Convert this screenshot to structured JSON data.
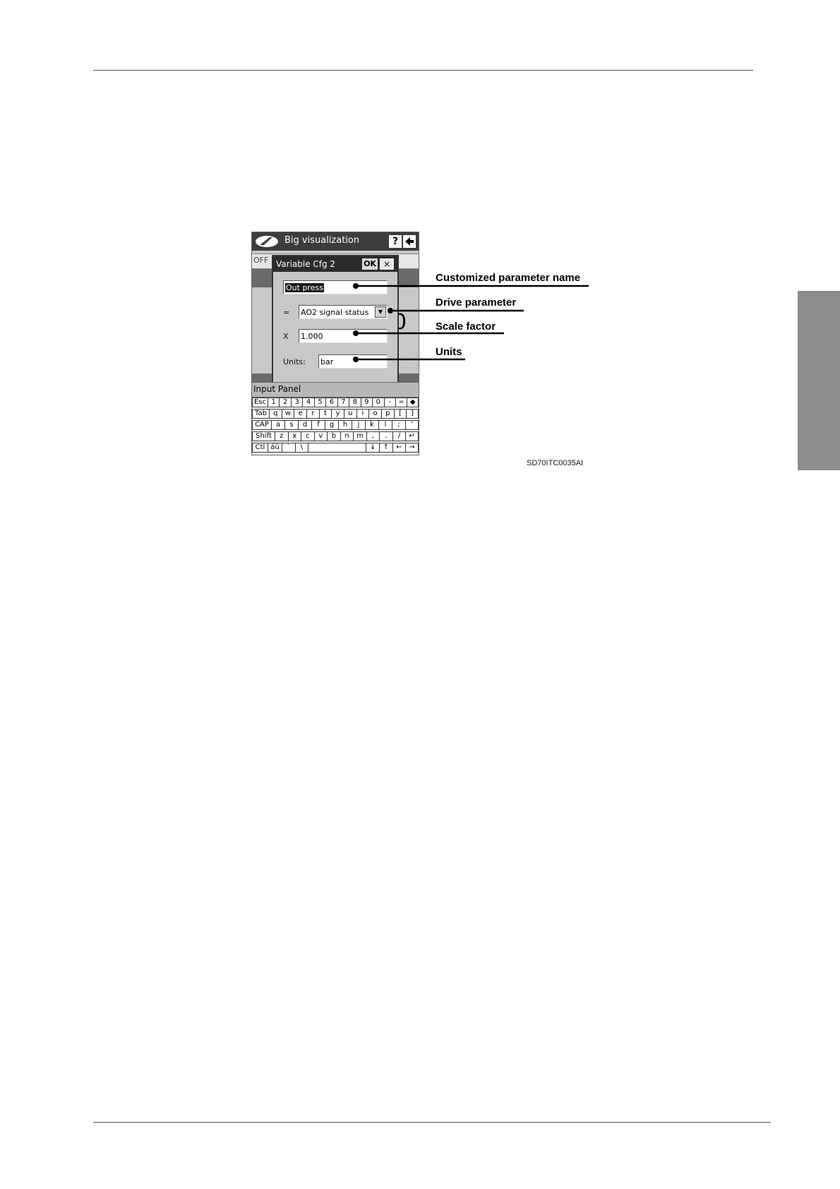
{
  "screen": {
    "app_title": "Big visualization",
    "help_icon": "help-icon",
    "back_icon": "back-arrow-icon",
    "background_off_label": "OFF"
  },
  "dialog": {
    "title": "Variable Cfg 2",
    "ok_label": "OK",
    "close_label": "×",
    "name_value": "Out press",
    "param_prefix": "=",
    "param_value": "AO2 signal status",
    "scale_prefix": "X",
    "scale_value": "1.000",
    "units_label": "Units:",
    "units_value": "bar"
  },
  "input_panel": {
    "title": "Input Panel",
    "rows": [
      [
        "Esc",
        "1",
        "2",
        "3",
        "4",
        "5",
        "6",
        "7",
        "8",
        "9",
        "0",
        "-",
        "=",
        "◆"
      ],
      [
        "Tab",
        "q",
        "w",
        "e",
        "r",
        "t",
        "y",
        "u",
        "i",
        "o",
        "p",
        "[",
        "]"
      ],
      [
        "CAP",
        "a",
        "s",
        "d",
        "f",
        "g",
        "h",
        "j",
        "k",
        "l",
        ";",
        "'"
      ],
      [
        "Shift",
        "z",
        "x",
        "c",
        "v",
        "b",
        "n",
        "m",
        ",",
        ".",
        "/",
        "↵"
      ],
      [
        "Ctl",
        "áü",
        "`",
        "\\",
        "",
        "↓",
        "↑",
        "←",
        "→"
      ]
    ]
  },
  "callouts": {
    "name": "Customized parameter name",
    "param": "Drive parameter",
    "scale": "Scale factor",
    "units": "Units"
  },
  "figure_code": "SD70ITC0035AI"
}
